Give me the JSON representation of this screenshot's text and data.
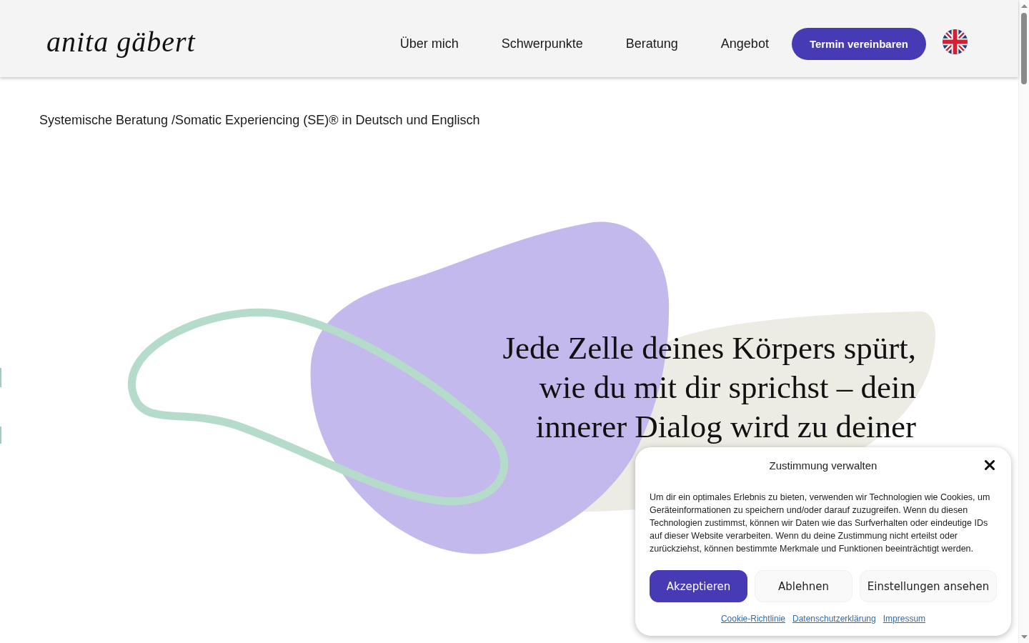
{
  "header": {
    "logo": "anita gäbert",
    "nav": [
      {
        "label": "Über mich"
      },
      {
        "label": "Schwerpunkte"
      },
      {
        "label": "Beratung"
      },
      {
        "label": "Angebot"
      }
    ],
    "cta": "Termin vereinbaren"
  },
  "tagline": "Systemische Beratung /Somatic Experiencing (SE)® in Deutsch und Englisch",
  "quote": "Jede Zelle deines Körpers spürt, wie du mit dir sprichst – dein innerer Dialog wird zu deiner",
  "cookie_dialog": {
    "title": "Zustimmung verwalten",
    "text": "Um dir ein optimales Erlebnis zu bieten, verwenden wir Technologien wie Cookies, um Geräteinformationen zu speichern und/oder darauf zuzugreifen. Wenn du diesen Technologien zustimmst, können wir Daten wie das Surfverhalten oder eindeutige IDs auf dieser Website verarbeiten. Wenn du deine Zustimmung nicht erteilst oder zurückziehst, können bestimmte Merkmale und Funktionen beeinträchtigt werden.",
    "buttons": [
      {
        "label": "Akzeptieren",
        "kind": "primary"
      },
      {
        "label": "Ablehnen",
        "kind": "secondary"
      },
      {
        "label": "Einstellungen ansehen",
        "kind": "secondary"
      }
    ],
    "links": [
      "Cookie-Richtlinie",
      "Datenschutzerklärung",
      "Impressum"
    ]
  }
}
